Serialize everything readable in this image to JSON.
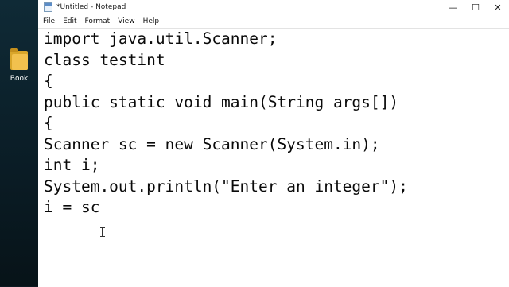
{
  "desktop": {
    "icon_label": "Book"
  },
  "window": {
    "title": "*Untitled - Notepad",
    "controls": {
      "minimize": "—",
      "maximize": "☐",
      "close": "✕"
    }
  },
  "menu": [
    "File",
    "Edit",
    "Format",
    "View",
    "Help"
  ],
  "editor": {
    "lines": [
      "import java.util.Scanner;",
      "class testint",
      "{",
      "public static void main(String args[])",
      "{",
      "Scanner sc = new Scanner(System.in);",
      "int i;",
      "System.out.println(\"Enter an integer\");",
      "i = sc"
    ]
  }
}
